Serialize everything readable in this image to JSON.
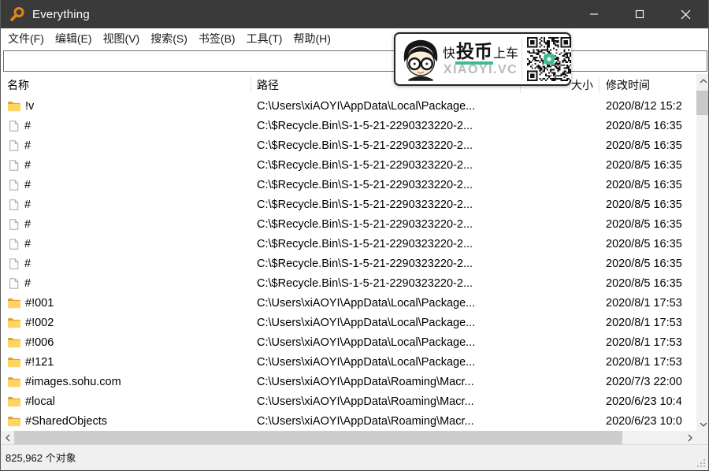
{
  "window": {
    "title": "Everything"
  },
  "titlebar": {
    "accent_orange": "#e8831c",
    "bg": "#3a3a3a",
    "buttons": [
      "minimize",
      "maximize",
      "close"
    ]
  },
  "menu": {
    "items": [
      "文件(F)",
      "编辑(E)",
      "视图(V)",
      "搜索(S)",
      "书签(B)",
      "工具(T)",
      "帮助(H)"
    ]
  },
  "search": {
    "value": "",
    "placeholder": ""
  },
  "columns": {
    "name": "名称",
    "path": "路径",
    "size": "大小",
    "modified": "修改时间"
  },
  "rows": [
    {
      "type": "folder",
      "name": "!v",
      "path": "C:\\Users\\xiAOYI\\AppData\\Local\\Package...",
      "size": "",
      "modified": "2020/8/12 15:2"
    },
    {
      "type": "file",
      "name": "#",
      "path": "C:\\$Recycle.Bin\\S-1-5-21-2290323220-2...",
      "size": "",
      "modified": "2020/8/5 16:35"
    },
    {
      "type": "file",
      "name": "#",
      "path": "C:\\$Recycle.Bin\\S-1-5-21-2290323220-2...",
      "size": "",
      "modified": "2020/8/5 16:35"
    },
    {
      "type": "file",
      "name": "#",
      "path": "C:\\$Recycle.Bin\\S-1-5-21-2290323220-2...",
      "size": "",
      "modified": "2020/8/5 16:35"
    },
    {
      "type": "file",
      "name": "#",
      "path": "C:\\$Recycle.Bin\\S-1-5-21-2290323220-2...",
      "size": "",
      "modified": "2020/8/5 16:35"
    },
    {
      "type": "file",
      "name": "#",
      "path": "C:\\$Recycle.Bin\\S-1-5-21-2290323220-2...",
      "size": "",
      "modified": "2020/8/5 16:35"
    },
    {
      "type": "file",
      "name": "#",
      "path": "C:\\$Recycle.Bin\\S-1-5-21-2290323220-2...",
      "size": "",
      "modified": "2020/8/5 16:35"
    },
    {
      "type": "file",
      "name": "#",
      "path": "C:\\$Recycle.Bin\\S-1-5-21-2290323220-2...",
      "size": "",
      "modified": "2020/8/5 16:35"
    },
    {
      "type": "file",
      "name": "#",
      "path": "C:\\$Recycle.Bin\\S-1-5-21-2290323220-2...",
      "size": "",
      "modified": "2020/8/5 16:35"
    },
    {
      "type": "file",
      "name": "#",
      "path": "C:\\$Recycle.Bin\\S-1-5-21-2290323220-2...",
      "size": "",
      "modified": "2020/8/5 16:35"
    },
    {
      "type": "folder",
      "name": "#!001",
      "path": "C:\\Users\\xiAOYI\\AppData\\Local\\Package...",
      "size": "",
      "modified": "2020/8/1 17:53"
    },
    {
      "type": "folder",
      "name": "#!002",
      "path": "C:\\Users\\xiAOYI\\AppData\\Local\\Package...",
      "size": "",
      "modified": "2020/8/1 17:53"
    },
    {
      "type": "folder",
      "name": "#!006",
      "path": "C:\\Users\\xiAOYI\\AppData\\Local\\Package...",
      "size": "",
      "modified": "2020/8/1 17:53"
    },
    {
      "type": "folder",
      "name": "#!121",
      "path": "C:\\Users\\xiAOYI\\AppData\\Local\\Package...",
      "size": "",
      "modified": "2020/8/1 17:53"
    },
    {
      "type": "folder",
      "name": "#images.sohu.com",
      "path": "C:\\Users\\xiAOYI\\AppData\\Roaming\\Macr...",
      "size": "",
      "modified": "2020/7/3 22:00"
    },
    {
      "type": "folder",
      "name": "#local",
      "path": "C:\\Users\\xiAOYI\\AppData\\Roaming\\Macr...",
      "size": "",
      "modified": "2020/6/23 10:4"
    },
    {
      "type": "folder",
      "name": "#SharedObjects",
      "path": "C:\\Users\\xiAOYI\\AppData\\Roaming\\Macr...",
      "size": "",
      "modified": "2020/6/23 10:0"
    }
  ],
  "statusbar": {
    "text": "825,962 个对象"
  },
  "watermark": {
    "pre": "快",
    "em": "投币",
    "post": "上车",
    "site": "XIAOYI.VC",
    "accent_green": "#3fbd8e"
  },
  "colors": {
    "titlebar_bg": "#3a3a3a",
    "folder_yellow": "#ffd464",
    "folder_yellow_dark": "#e3a02f",
    "scrollbar_track": "#f1f1f1",
    "scrollbar_thumb": "#c9c9c9",
    "status_bg": "#f0f0f0"
  }
}
